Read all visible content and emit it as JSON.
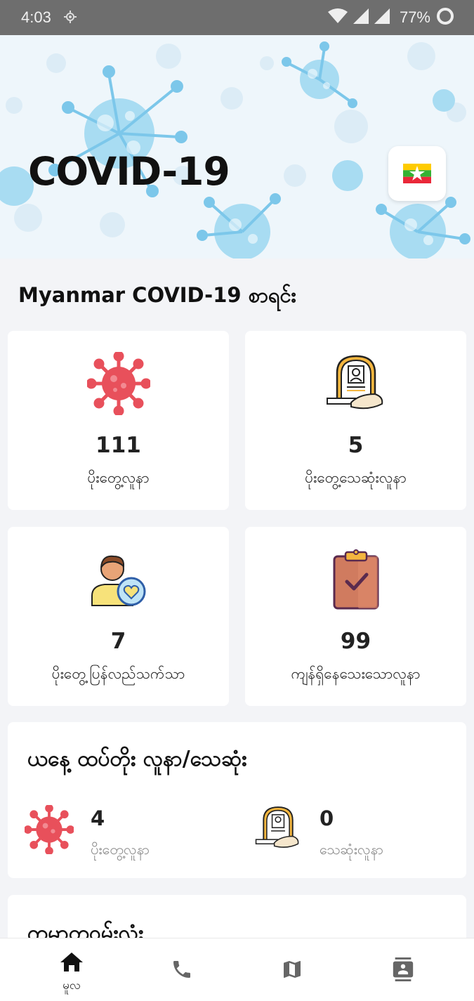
{
  "status_bar": {
    "time": "4:03",
    "battery": "77%"
  },
  "header": {
    "title": "COVID-19",
    "flag_icon": "myanmar-flag-icon"
  },
  "section_title": "Myanmar COVID-19 စာရင်း",
  "stats": [
    {
      "value": "111",
      "label": "ပိုးတွေ့လူနာ",
      "icon": "virus-icon"
    },
    {
      "value": "5",
      "label": "ပိုးတွေ့သေဆုံးလူနာ",
      "icon": "grave-icon"
    },
    {
      "value": "7",
      "label": "ပိုးတွေ့ပြန်လည်သက်သာ",
      "icon": "recovered-person-icon"
    },
    {
      "value": "99",
      "label": "ကျန်ရှိနေသေးသောလူနာ",
      "icon": "clipboard-check-icon"
    }
  ],
  "today": {
    "heading": "ယနေ့ ထပ်တိုး လူနာ/သေဆုံး",
    "cases_value": "4",
    "cases_label": "ပိုးတွေ့လူနာ",
    "deaths_value": "0",
    "deaths_label": "သေဆုံးလူနာ"
  },
  "map_section": {
    "heading": "ကမာတဝမ်းလံး"
  },
  "bottom_nav": [
    {
      "label": "မူလ",
      "icon": "home-icon"
    },
    {
      "label": "",
      "icon": "phone-icon"
    },
    {
      "label": "",
      "icon": "map-icon"
    },
    {
      "label": "",
      "icon": "contact-card-icon"
    }
  ],
  "colors": {
    "virus_red": "#e8505b",
    "banner_bg": "#eef6fb",
    "virus_blue": "#7cc7ea"
  }
}
